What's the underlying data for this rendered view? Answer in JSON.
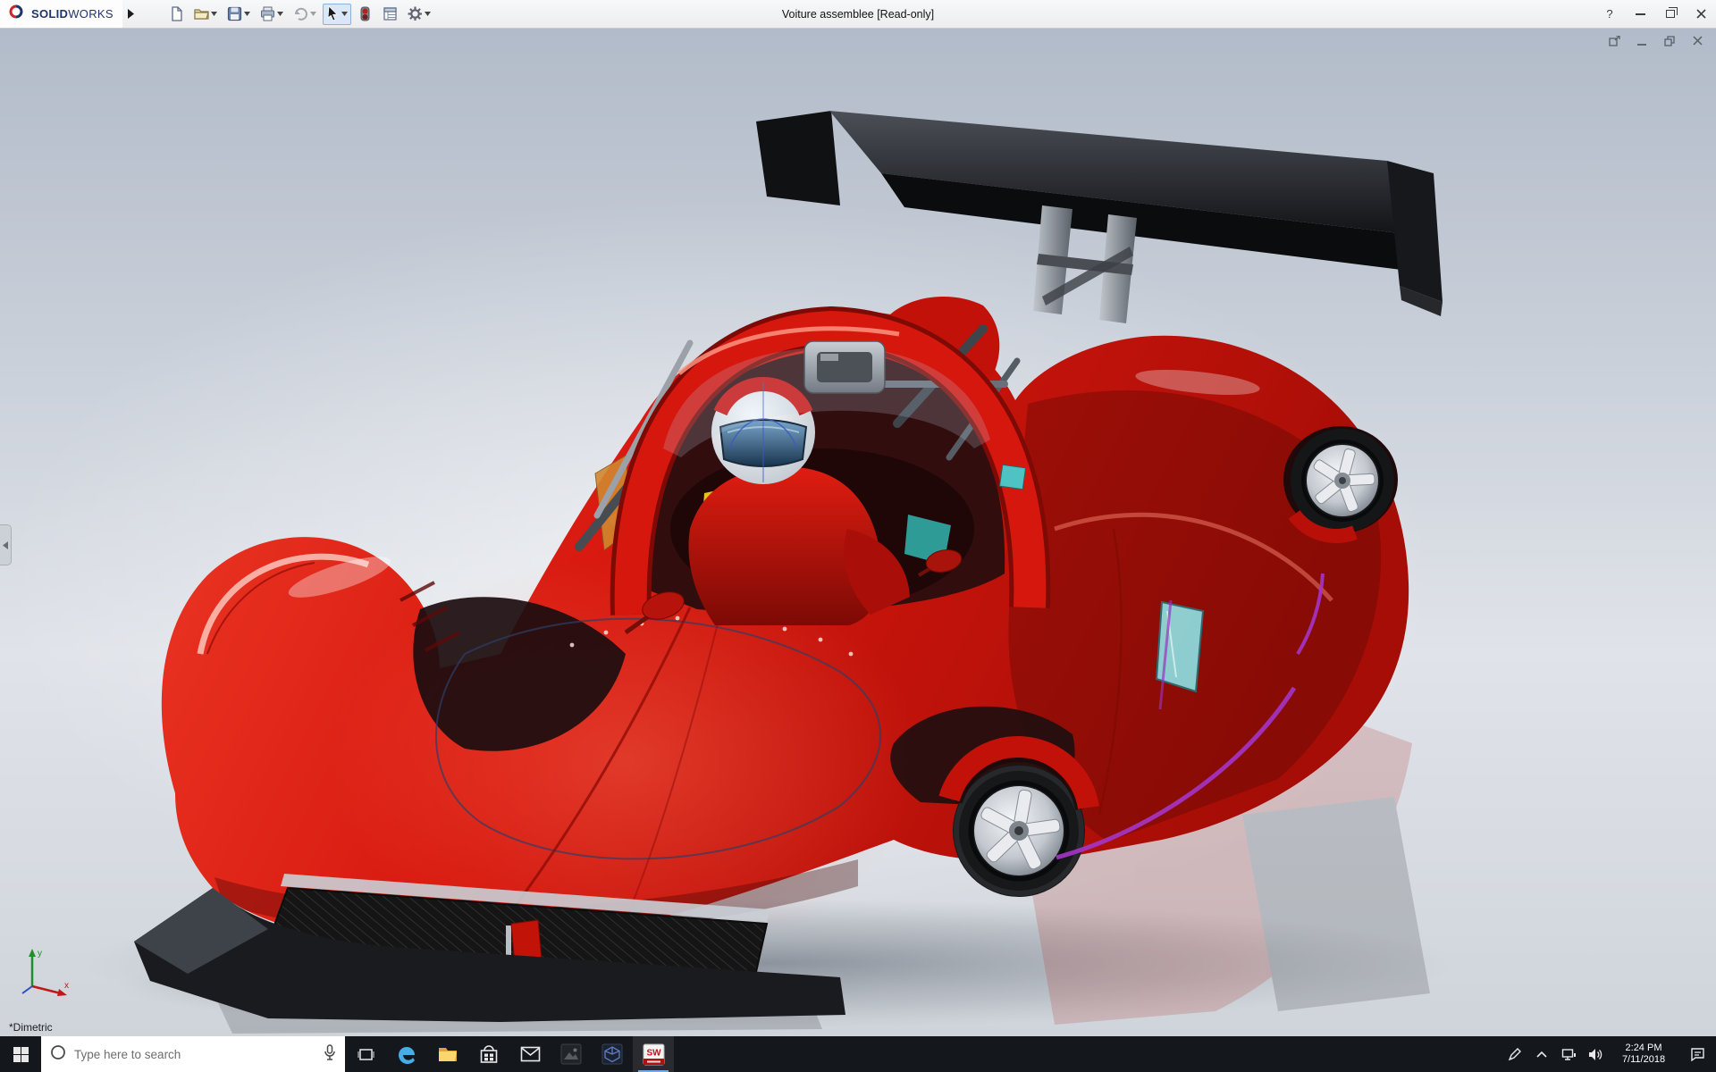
{
  "app": {
    "brand": {
      "logo_icon": "dassault-systemes-logo-icon",
      "name_bold": "SOLID",
      "name_light": "WORKS"
    },
    "title": "Voiture assemblee [Read-only]",
    "window_controls": {
      "help": "?",
      "buttons": [
        "help",
        "minimize",
        "restore",
        "close"
      ]
    }
  },
  "menu": {
    "flyout_icon": "expand-menubar-arrow-icon"
  },
  "toolbar": {
    "items": [
      {
        "id": "new",
        "icon": "new-document-icon",
        "dropdown": false
      },
      {
        "id": "open",
        "icon": "open-folder-icon",
        "dropdown": true
      },
      {
        "id": "save",
        "icon": "save-icon",
        "dropdown": true
      },
      {
        "id": "print",
        "icon": "print-icon",
        "dropdown": true
      },
      {
        "id": "undo",
        "icon": "undo-icon",
        "dropdown": true
      },
      {
        "id": "select",
        "icon": "select-cursor-icon",
        "dropdown": true,
        "active": true
      },
      {
        "id": "rebuild",
        "icon": "rebuild-icon",
        "dropdown": false
      },
      {
        "id": "file-properties",
        "icon": "file-properties-icon",
        "dropdown": false
      },
      {
        "id": "options",
        "icon": "options-gear-icon",
        "dropdown": true
      }
    ]
  },
  "document_window": {
    "controls": [
      {
        "id": "undock",
        "icon": "undock-window-icon"
      },
      {
        "id": "minimize",
        "icon": "minimize-window-icon"
      },
      {
        "id": "restore",
        "icon": "restore-window-icon"
      },
      {
        "id": "close",
        "icon": "close-window-icon"
      }
    ]
  },
  "viewport": {
    "view_orientation_label": "*Dimetric",
    "triad": {
      "x_label": "x",
      "y_label": "y"
    },
    "collapse_tab_icon": "collapse-panel-arrow-icon",
    "model": {
      "name": "Voiture assemblee",
      "kind": "3D assembly - red prototype race car with driver figure and black rear wing, shown on reflective floor",
      "colors": {
        "body_red": "#d6170e",
        "wing_black": "#141518",
        "helmet_white": "#f4f6f8",
        "visor_blue": "#2c4f72",
        "glass_cyan": "#8fd8da",
        "trim_purple": "#a435c8",
        "rim_silver": "#c7cbd1"
      }
    }
  },
  "taskbar": {
    "start_icon": "windows-start-icon",
    "search": {
      "placeholder": "Type here to search",
      "left_icon": "search-circle-icon",
      "right_icon": "microphone-icon"
    },
    "task_view_icon": "task-view-icon",
    "apps": [
      {
        "id": "edge",
        "icon": "edge-icon"
      },
      {
        "id": "file-explorer",
        "icon": "file-explorer-icon"
      },
      {
        "id": "store",
        "icon": "store-icon"
      },
      {
        "id": "mail",
        "icon": "mail-icon"
      },
      {
        "id": "photos",
        "icon": "photos-app-icon"
      },
      {
        "id": "media",
        "icon": "media-app-icon"
      },
      {
        "id": "solidworks",
        "icon": "solidworks-app-icon",
        "active": true
      }
    ],
    "tray": {
      "icons": [
        "ink-workspace-icon",
        "hidden-icons-caret-icon",
        "network-icon",
        "volume-icon"
      ],
      "clock": {
        "time": "2:24 PM",
        "date": "7/11/2018"
      },
      "action_center_icon": "action-center-icon"
    }
  }
}
